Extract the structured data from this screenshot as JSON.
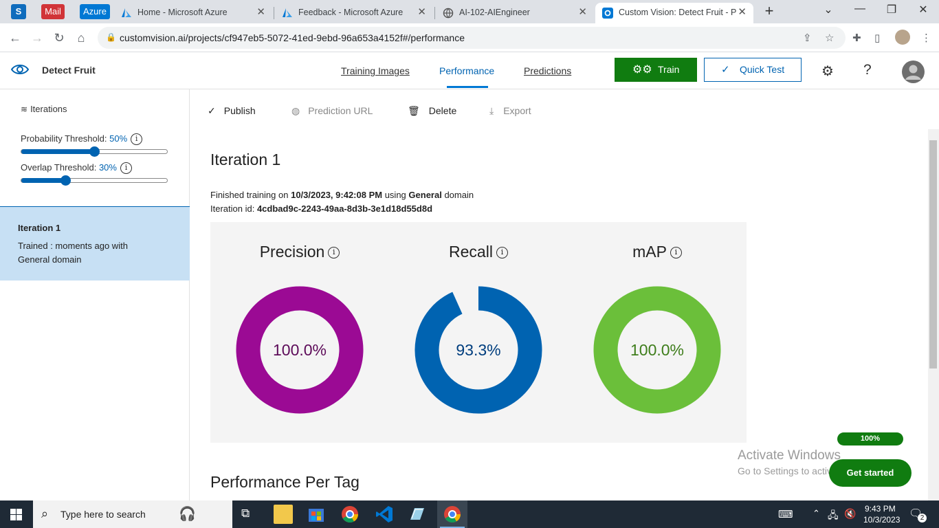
{
  "browser": {
    "bookmarks": [
      {
        "label": "S",
        "color": "#0f6cbd"
      },
      {
        "label": "Mail",
        "color": "#d13438"
      },
      {
        "label": "Azure",
        "color": "#0078d4"
      }
    ],
    "tabs": [
      {
        "title": "Home - Microsoft Azure",
        "active": false
      },
      {
        "title": "Feedback - Microsoft Azure",
        "active": false
      },
      {
        "title": "AI-102-AIEngineer",
        "active": false
      },
      {
        "title": "Custom Vision: Detect Fruit - P",
        "active": true
      }
    ],
    "url": "customvision.ai/projects/cf947eb5-5072-41ed-9ebd-96a653a4152f#/performance"
  },
  "app": {
    "project_title": "Detect Fruit",
    "nav": [
      {
        "label": "Training Images"
      },
      {
        "label": "Performance"
      },
      {
        "label": "Predictions"
      }
    ],
    "train_label": "Train",
    "quicktest_label": "Quick Test",
    "help_label": "?"
  },
  "sidebar": {
    "iterations_label": "Iterations",
    "prob_label": "Probability Threshold:",
    "prob_value": "50%",
    "prob_fraction": 0.5,
    "overlap_label": "Overlap Threshold:",
    "overlap_value": "30%",
    "overlap_fraction": 0.3,
    "iteration": {
      "name": "Iteration 1",
      "line1": "Trained : moments ago with",
      "line2": "General domain"
    }
  },
  "toolbar": {
    "publish": "Publish",
    "prediction_url": "Prediction URL",
    "delete": "Delete",
    "export": "Export"
  },
  "main": {
    "heading": "Iteration 1",
    "finished_prefix": "Finished training on",
    "finished_date": "10/3/2023, 9:42:08 PM",
    "using": "using",
    "domain": "General",
    "domain_suffix": "domain",
    "iter_id_label": "Iteration id:",
    "iter_id": "4cdbad9c-2243-49aa-8d3b-3e1d18d55d8d",
    "metrics": [
      {
        "name": "Precision",
        "value_text": "100.0%",
        "value": 100.0,
        "color": "#9b0a94",
        "text_color": "#5c0a58"
      },
      {
        "name": "Recall",
        "value_text": "93.3%",
        "value": 93.3,
        "color": "#0063b1",
        "text_color": "#003e7e"
      },
      {
        "name": "mAP",
        "value_text": "100.0%",
        "value": 100.0,
        "color": "#6bbf3a",
        "text_color": "#3e7d1b"
      }
    ],
    "perf_per_tag": "Performance Per Tag"
  },
  "overlay": {
    "progress": "100%",
    "get_started": "Get started",
    "activate_title": "Activate Windows",
    "activate_sub": "Go to Settings to activate Windows."
  },
  "taskbar": {
    "search_placeholder": "Type here to search",
    "time": "9:43 PM",
    "date": "10/3/2023",
    "notifications": "2"
  }
}
